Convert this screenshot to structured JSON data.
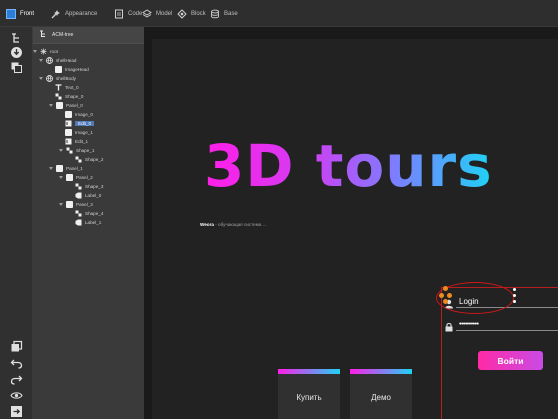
{
  "toolbar": {
    "tabs": [
      {
        "label": "Front",
        "icon": "front-icon"
      },
      {
        "label": "Appearance",
        "icon": "wand-icon"
      },
      {
        "label": "Code",
        "icon": "code-icon"
      },
      {
        "label": "Model",
        "icon": "layers-icon"
      },
      {
        "label": "Block",
        "icon": "block-icon"
      },
      {
        "label": "Base",
        "icon": "database-icon"
      }
    ],
    "active_tab": "Front"
  },
  "tree": {
    "header": "ACM-tree",
    "items": [
      {
        "label": "root",
        "icon": "root-icon"
      },
      {
        "label": "shellHead",
        "icon": "globe-icon"
      },
      {
        "label": "ImageHead",
        "icon": "image-icon"
      },
      {
        "label": "shellBody",
        "icon": "globe-icon"
      },
      {
        "label": "Text_0",
        "icon": "text-icon"
      },
      {
        "label": "Shape_0",
        "icon": "shape-icon"
      },
      {
        "label": "Panel_0",
        "icon": "panel-icon"
      },
      {
        "label": "Image_0",
        "icon": "image-icon"
      },
      {
        "label": "Edit_0",
        "icon": "edit-icon",
        "selected": true
      },
      {
        "label": "Image_1",
        "icon": "image-icon"
      },
      {
        "label": "Edit_1",
        "icon": "edit-icon"
      },
      {
        "label": "Shape_1",
        "icon": "shape-icon"
      },
      {
        "label": "Shape_2",
        "icon": "shape-icon"
      },
      {
        "label": "Panel_1",
        "icon": "panel-icon"
      },
      {
        "label": "Panel_2",
        "icon": "panel-icon"
      },
      {
        "label": "Shape_3",
        "icon": "shape-icon"
      },
      {
        "label": "Label_0",
        "icon": "label-icon"
      },
      {
        "label": "Panel_3",
        "icon": "panel-icon"
      },
      {
        "label": "Shape_4",
        "icon": "shape-icon"
      },
      {
        "label": "Label_1",
        "icon": "label-icon"
      }
    ]
  },
  "canvas": {
    "title": "3D tours",
    "subtitle_brand": "Weora",
    "subtitle_text": " - обучающая система ...",
    "login": {
      "username_value": "Login",
      "password_value": "••••••••••",
      "submit_label": "Войти"
    },
    "cards": [
      {
        "label": "Купить"
      },
      {
        "label": "Демо"
      }
    ]
  },
  "colors": {
    "accent": "#2d7fd6",
    "gradient_start": "#ff1ee8",
    "gradient_end": "#1ed3f5",
    "selection": "#d01818"
  }
}
